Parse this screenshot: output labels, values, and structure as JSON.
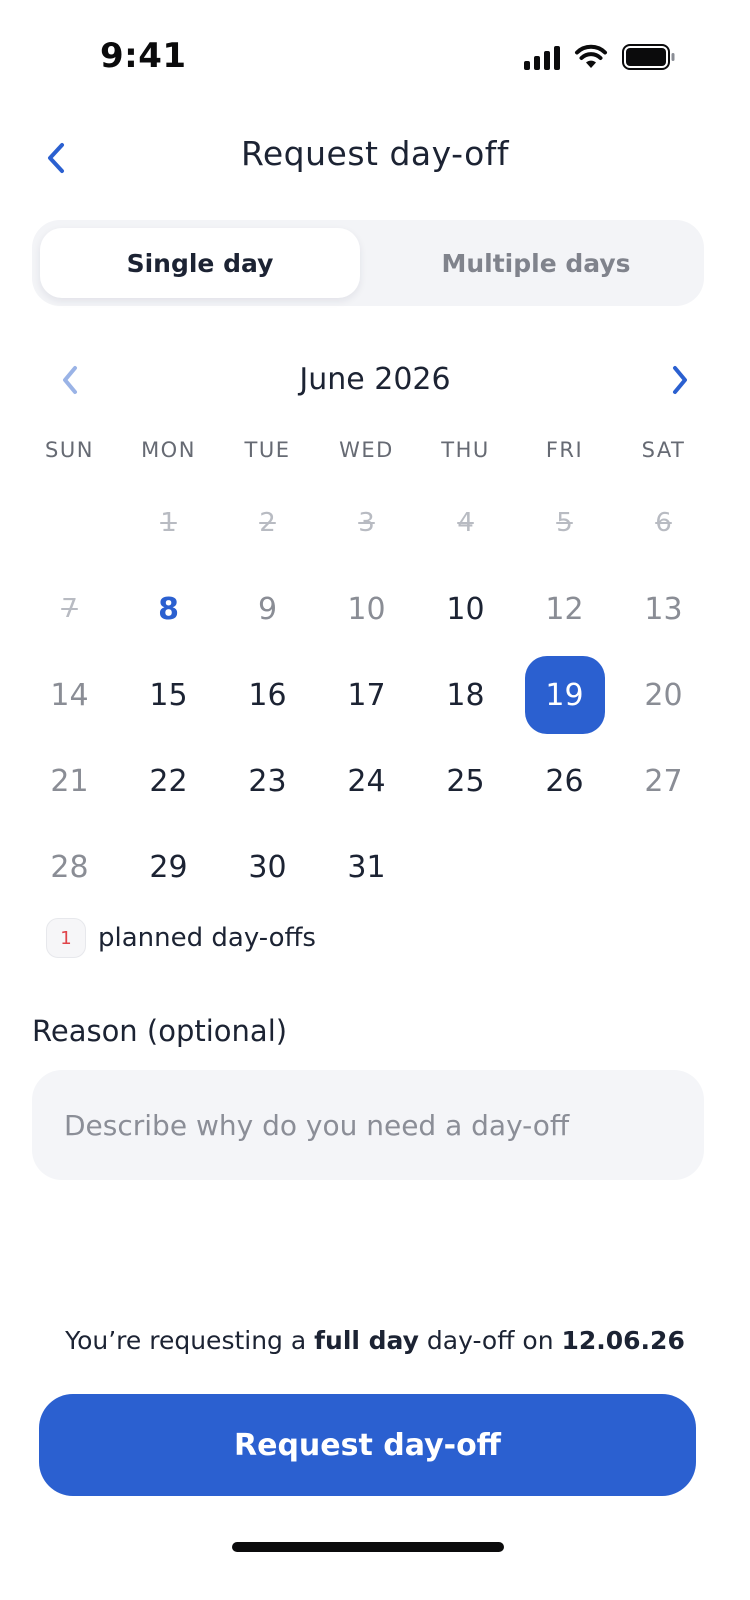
{
  "status_bar": {
    "time": "9:41",
    "icons": [
      "signal-icon",
      "wifi-icon",
      "battery-icon"
    ]
  },
  "header": {
    "title": "Request day-off",
    "back_icon": "chevron-left-icon"
  },
  "mode_tabs": {
    "single": "Single day",
    "multiple": "Multiple days",
    "active": "single"
  },
  "calendar": {
    "month_label": "June 2026",
    "prev_icon": "chevron-left-icon",
    "next_icon": "chevron-right-icon",
    "weekdays": [
      "SUN",
      "MON",
      "TUE",
      "WED",
      "THU",
      "FRI",
      "SAT"
    ],
    "weeks": [
      [
        {
          "label": "",
          "state": "empty"
        },
        {
          "label": "1",
          "state": "past"
        },
        {
          "label": "2",
          "state": "past"
        },
        {
          "label": "3",
          "state": "past"
        },
        {
          "label": "4",
          "state": "past"
        },
        {
          "label": "5",
          "state": "past"
        },
        {
          "label": "6",
          "state": "past"
        }
      ],
      [
        {
          "label": "7",
          "state": "past"
        },
        {
          "label": "8",
          "state": "today"
        },
        {
          "label": "9",
          "state": "muted"
        },
        {
          "label": "10",
          "state": "muted"
        },
        {
          "label": "10",
          "state": "available"
        },
        {
          "label": "12",
          "state": "muted"
        },
        {
          "label": "13",
          "state": "weekend"
        }
      ],
      [
        {
          "label": "14",
          "state": "weekend"
        },
        {
          "label": "15",
          "state": "available"
        },
        {
          "label": "16",
          "state": "available"
        },
        {
          "label": "17",
          "state": "available"
        },
        {
          "label": "18",
          "state": "available"
        },
        {
          "label": "19",
          "state": "selected"
        },
        {
          "label": "20",
          "state": "weekend"
        }
      ],
      [
        {
          "label": "21",
          "state": "weekend"
        },
        {
          "label": "22",
          "state": "available"
        },
        {
          "label": "23",
          "state": "available"
        },
        {
          "label": "24",
          "state": "available"
        },
        {
          "label": "25",
          "state": "available"
        },
        {
          "label": "26",
          "state": "available"
        },
        {
          "label": "27",
          "state": "weekend"
        }
      ],
      [
        {
          "label": "28",
          "state": "weekend"
        },
        {
          "label": "29",
          "state": "available"
        },
        {
          "label": "30",
          "state": "available"
        },
        {
          "label": "31",
          "state": "available"
        },
        {
          "label": "",
          "state": "empty"
        },
        {
          "label": "",
          "state": "empty"
        },
        {
          "label": "",
          "state": "empty"
        }
      ]
    ],
    "legend": {
      "count": "1",
      "text": "planned day-offs"
    }
  },
  "reason": {
    "label": "Reason (optional)",
    "value": "",
    "placeholder": "Describe why do you need a day-off"
  },
  "summary": {
    "prefix": "You’re requesting a ",
    "duration": "full day",
    "middle": " day-off on ",
    "date": "12.06.26"
  },
  "submit": {
    "label": "Request day-off"
  },
  "colors": {
    "accent": "#2b60d0",
    "text": "#1c2333",
    "muted": "#8a8d95",
    "badge_text": "#e0444a"
  }
}
